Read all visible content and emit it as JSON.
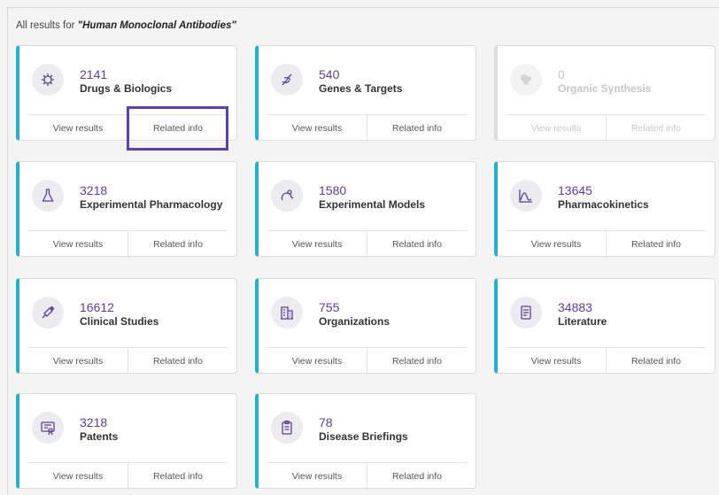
{
  "heading": {
    "prefix": "All results for ",
    "query": "\"Human Monoclonal Antibodies\""
  },
  "colors": {
    "accent": "#1fb3d1",
    "count": "#5b3d9e",
    "highlight": "#5d3fb3"
  },
  "cards": [
    {
      "count": "2141",
      "label": "Drugs & Biologics",
      "icon": "capsule-gear-icon",
      "view": "View results",
      "related": "Related info"
    },
    {
      "count": "540",
      "label": "Genes & Targets",
      "icon": "dna-icon",
      "view": "View results",
      "related": "Related info"
    },
    {
      "count": "0",
      "label": "Organic Synthesis",
      "icon": "molecule-icon",
      "view": "View results",
      "related": "Related info",
      "disabled": true
    },
    {
      "count": "3218",
      "label": "Experimental Pharmacology",
      "icon": "flask-icon",
      "view": "View results",
      "related": "Related info"
    },
    {
      "count": "1580",
      "label": "Experimental Models",
      "icon": "mouse-icon",
      "view": "View results",
      "related": "Related info"
    },
    {
      "count": "13645",
      "label": "Pharmacokinetics",
      "icon": "curve-chart-icon",
      "view": "View results",
      "related": "Related info"
    },
    {
      "count": "16612",
      "label": "Clinical Studies",
      "icon": "syringe-icon",
      "view": "View results",
      "related": "Related info"
    },
    {
      "count": "755",
      "label": "Organizations",
      "icon": "building-icon",
      "view": "View results",
      "related": "Related info"
    },
    {
      "count": "34883",
      "label": "Literature",
      "icon": "journal-icon",
      "view": "View results",
      "related": "Related info"
    },
    {
      "count": "3218",
      "label": "Patents",
      "icon": "certificate-icon",
      "view": "View results",
      "related": "Related info"
    },
    {
      "count": "78",
      "label": "Disease Briefings",
      "icon": "clipboard-icon",
      "view": "View results",
      "related": "Related info"
    }
  ]
}
